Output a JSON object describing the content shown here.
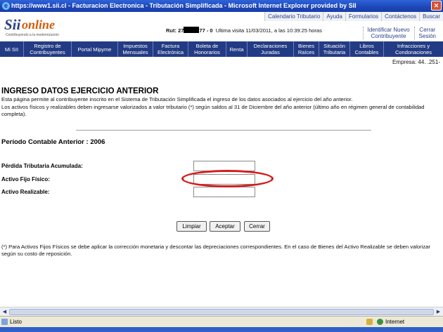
{
  "window": {
    "title": "https://www1.sii.cl - Facturacion Electronica - Tributación Simplificada - Microsoft Internet Explorer provided by SII"
  },
  "logo": {
    "text_sii": "Sii",
    "text_online": "online",
    "tagline": "Contribuyendo a la modernización"
  },
  "top_links": [
    "Calendario Tributario",
    "Ayuda",
    "Formularios",
    "Contáctenos",
    "Buscar"
  ],
  "user": {
    "rut_label": "Rut: 27",
    "rut_suffix": "77 - 0",
    "last_visit": "Ultima visita 11/03/2011, a las 10:39:25 horas"
  },
  "right_links": [
    {
      "line1": "Identificar Nuevo",
      "line2": "Contribuyente"
    },
    {
      "line1": "Cerrar",
      "line2": "Sesión"
    }
  ],
  "nav": [
    {
      "l1": "Mi SII",
      "l2": ""
    },
    {
      "l1": "Registro de",
      "l2": "Contribuyentes"
    },
    {
      "l1": "Portal Mipyme",
      "l2": ""
    },
    {
      "l1": "Impuestos",
      "l2": "Mensuales"
    },
    {
      "l1": "Factura",
      "l2": "Electrónica"
    },
    {
      "l1": "Boleta de",
      "l2": "Honorarios"
    },
    {
      "l1": "Renta",
      "l2": ""
    },
    {
      "l1": "Declaraciones",
      "l2": "Juradas"
    },
    {
      "l1": "Bienes",
      "l2": "Raíces"
    },
    {
      "l1": "Situación",
      "l2": "Tributaria"
    },
    {
      "l1": "Libros",
      "l2": "Contables"
    },
    {
      "l1": "Infracciones y",
      "l2": "Condonaciones"
    }
  ],
  "empresa": "Empresa: 44.      .251-",
  "page": {
    "title": "INGRESO DATOS EJERCICIO ANTERIOR",
    "desc1": "Esta página permite al contribuyente inscrito en el Sistema de Tributación Simplificada el ingreso de los datos asociados al ejercicio del año anterior.",
    "desc2": "Los activos físicos y realizables deben ingresarse valorizados a valor tributario (*) según saldos al 31 de Diciembre del año anterior (último año en régimen general de contabilidad completa).",
    "periodo": "Período Contable Anterior :  2006"
  },
  "fields": [
    {
      "label": "Pérdida Tributaria Acumulada:",
      "value": ""
    },
    {
      "label": "Activo Fijo Físico:",
      "value": ""
    },
    {
      "label": "Activo Realizable:",
      "value": ""
    }
  ],
  "buttons": {
    "clear": "Limpiar",
    "accept": "Aceptar",
    "close": "Cerrar"
  },
  "footnote": "(*) Para Activos Fijos Físicos se debe aplicar la corrección monetaria y descontar las depreciaciones correspondientes. En el caso de Bienes del Activo Realizable se deben valorizar según su costo de reposición.",
  "status": {
    "text": "Listo",
    "zone": "Internet"
  },
  "colors": {
    "nav_bg": "#233b84",
    "title_bar": "#1c46b8",
    "highlight": "#d41b1b"
  }
}
